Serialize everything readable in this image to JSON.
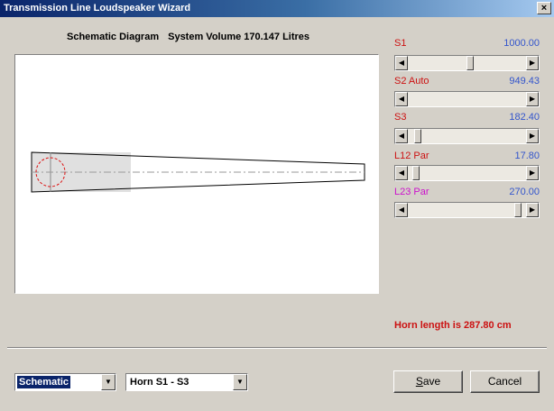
{
  "window": {
    "title": "Transmission Line Loudspeaker Wizard",
    "close_symbol": "×"
  },
  "heading": {
    "diagram": "Schematic Diagram",
    "volume": "System Volume 170.147 Litres"
  },
  "params": [
    {
      "label": "S1",
      "mode": "",
      "value": "1000.00",
      "level": 0.53,
      "color": "#cc1111"
    },
    {
      "label": "S2",
      "mode": "Auto",
      "value": "949.43",
      "level": 1.0,
      "color": "#cc1111"
    },
    {
      "label": "S3",
      "mode": "",
      "value": "182.40",
      "level": 0.06,
      "color": "#cc1111"
    },
    {
      "label": "L12",
      "mode": "Par",
      "value": "17.80",
      "level": 0.04,
      "color": "#cc1111"
    },
    {
      "label": "L23",
      "mode": "Par",
      "value": "270.00",
      "level": 0.96,
      "color": "#cc11cc"
    }
  ],
  "horn_length": "Horn length is 287.80 cm",
  "view_select": {
    "value": "Schematic"
  },
  "horn_select": {
    "value": "Horn S1 - S3"
  },
  "buttons": {
    "save_first": "S",
    "save_rest": "ave",
    "cancel": "Cancel"
  },
  "colors": {
    "accent_red": "#cc1111",
    "accent_blue": "#3355cc",
    "accent_magenta": "#cc11cc",
    "titlebar_start": "#0a246a"
  }
}
